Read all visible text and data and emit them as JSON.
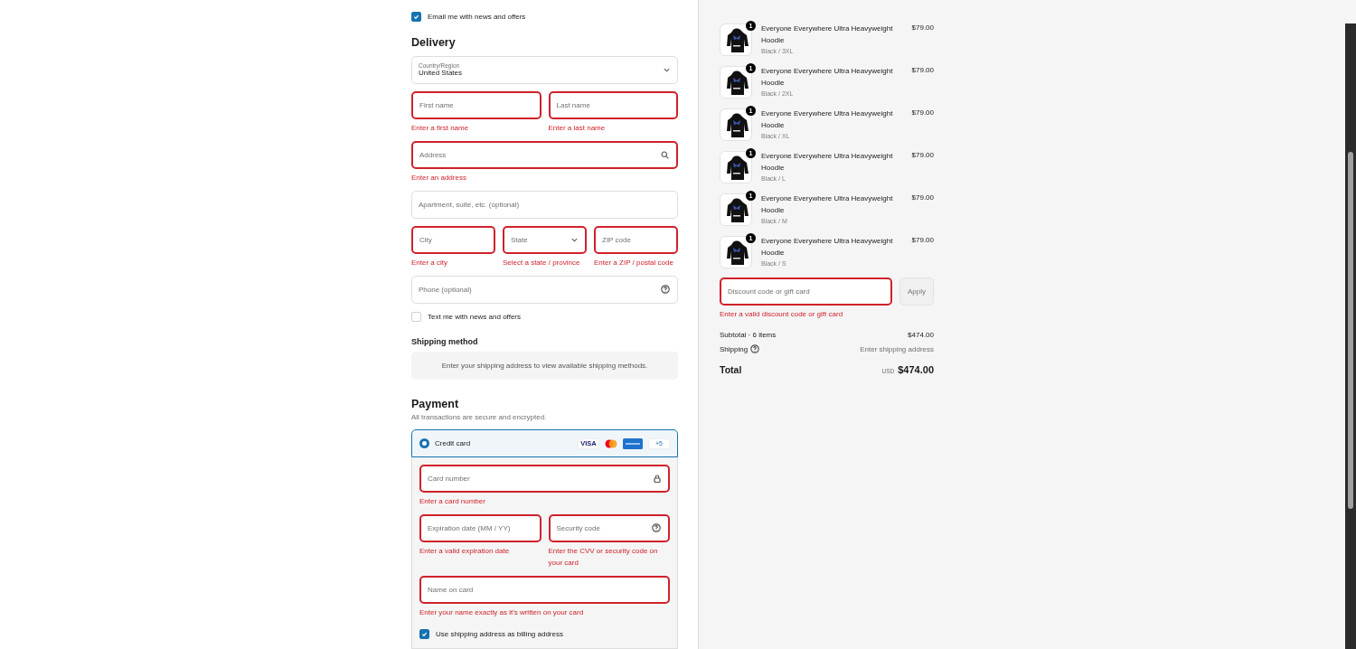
{
  "contact": {
    "newsletter": {
      "label": "Email me with news and offers",
      "checked": true
    }
  },
  "delivery": {
    "title": "Delivery",
    "country": {
      "label": "Country/Region",
      "value": "United States"
    },
    "rows": [
      [
        {
          "placeholder": "First name",
          "kind": "text",
          "invalid": true,
          "error": "Enter a first name"
        },
        {
          "placeholder": "Last name",
          "kind": "text",
          "invalid": true,
          "error": "Enter a last name"
        }
      ],
      [
        {
          "placeholder": "Address",
          "kind": "search",
          "invalid": true,
          "error": "Enter an address"
        }
      ],
      [
        {
          "placeholder": "Apartment, suite, etc. (optional)",
          "kind": "text",
          "invalid": false
        }
      ],
      [
        {
          "placeholder": "City",
          "kind": "text",
          "invalid": true,
          "error": "Enter a city"
        },
        {
          "placeholder": "State",
          "kind": "select",
          "invalid": true,
          "error": "Select a state / province"
        },
        {
          "placeholder": "ZIP code",
          "kind": "text",
          "invalid": true,
          "error": "Enter a ZIP / postal code"
        }
      ],
      [
        {
          "placeholder": "Phone (optional)",
          "kind": "help",
          "invalid": false
        }
      ]
    ],
    "sms": {
      "label": "Text me with news and offers",
      "checked": false
    }
  },
  "shipping_method": {
    "title": "Shipping method",
    "notice": "Enter your shipping address to view available shipping methods."
  },
  "payment": {
    "title": "Payment",
    "subtitle": "All transactions are secure and encrypted.",
    "method": {
      "label": "Credit card",
      "selected": true,
      "brands": [
        {
          "kind": "visa",
          "label": "VISA"
        },
        {
          "kind": "mastercard"
        },
        {
          "kind": "amex"
        }
      ],
      "more": "+5"
    },
    "rows": [
      [
        {
          "placeholder": "Card number",
          "kind": "lock",
          "invalid": true,
          "error": "Enter a card number"
        }
      ],
      [
        {
          "placeholder": "Expiration date (MM / YY)",
          "kind": "text",
          "invalid": true,
          "error": "Enter a valid expiration date"
        },
        {
          "placeholder": "Security code",
          "kind": "help",
          "invalid": true,
          "error": "Enter the CVV or security code on your card"
        }
      ],
      [
        {
          "placeholder": "Name on card",
          "kind": "text",
          "invalid": true,
          "error": "Enter your name exactly as it's written on your card"
        }
      ]
    ],
    "billing": {
      "label": "Use shipping address as billing address",
      "checked": true
    }
  },
  "order": {
    "items": [
      {
        "quantity": "1",
        "name": "Everyone Everywhere Ultra Heavyweight Hoodie",
        "variant": "Black / 3XL",
        "price": "$79.00"
      },
      {
        "quantity": "1",
        "name": "Everyone Everywhere Ultra Heavyweight Hoodie",
        "variant": "Black / 2XL",
        "price": "$79.00"
      },
      {
        "quantity": "1",
        "name": "Everyone Everywhere Ultra Heavyweight Hoodie",
        "variant": "Black / XL",
        "price": "$79.00"
      },
      {
        "quantity": "1",
        "name": "Everyone Everywhere Ultra Heavyweight Hoodie",
        "variant": "Black / L",
        "price": "$79.00"
      },
      {
        "quantity": "1",
        "name": "Everyone Everywhere Ultra Heavyweight Hoodie",
        "variant": "Black / M",
        "price": "$79.00"
      },
      {
        "quantity": "1",
        "name": "Everyone Everywhere Ultra Heavyweight Hoodie",
        "variant": "Black / S",
        "price": "$79.00"
      }
    ],
    "discount": {
      "placeholder": "Discount code or gift card",
      "invalid": true,
      "error": "Enter a valid discount code or gift card",
      "button": "Apply"
    },
    "subtotal": {
      "label": "Subtotal · 6 items",
      "value": "$474.00"
    },
    "shipping": {
      "label": "Shipping",
      "value": "Enter shipping address"
    },
    "total": {
      "label": "Total",
      "currency": "USD",
      "value": "$474.00"
    }
  }
}
